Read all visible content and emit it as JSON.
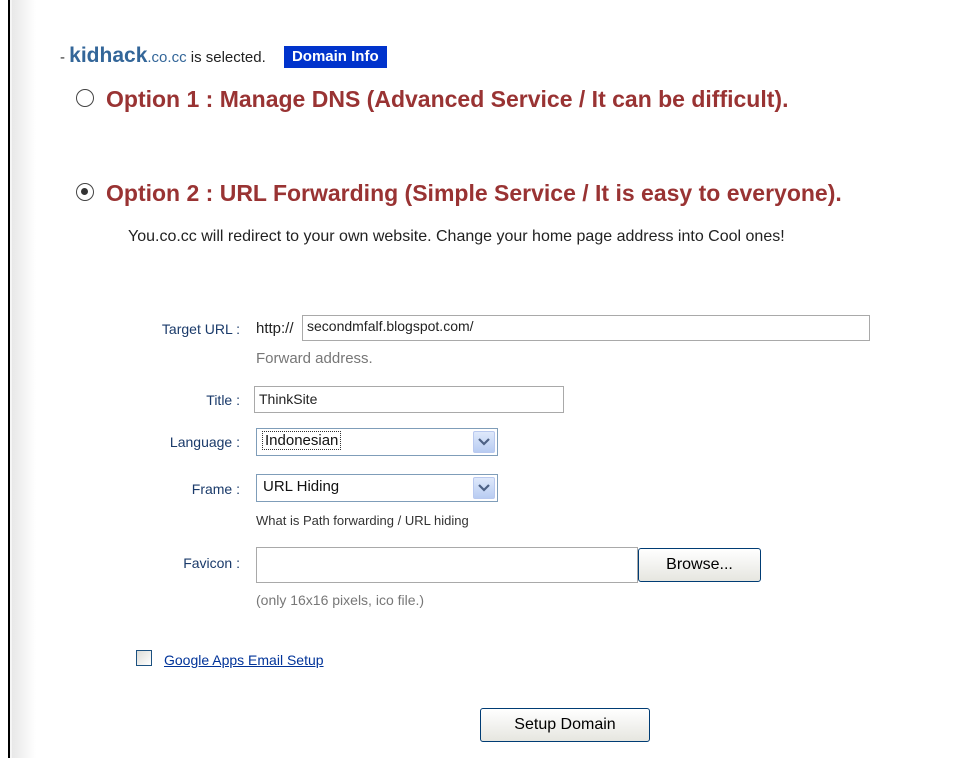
{
  "selection": {
    "dash": "-",
    "domain_name": "kidhack",
    "domain_tld": ".co.cc",
    "suffix": "is selected.",
    "domain_info_button": "Domain Info"
  },
  "options": {
    "option1_label": "Option 1 : Manage DNS (Advanced Service / It can be difficult).",
    "option1_checked": false,
    "option2_label": "Option 2 : URL Forwarding (Simple Service / It is easy to everyone).",
    "option2_checked": true,
    "option2_description": "You.co.cc will redirect to your own website. Change your home page address into Cool ones!"
  },
  "form": {
    "target_url": {
      "label": "Target URL :",
      "prefix": "http://",
      "value": "secondmfalf.blogspot.com/",
      "hint": "Forward address."
    },
    "title": {
      "label": "Title :",
      "value": "ThinkSite"
    },
    "language": {
      "label": "Language :",
      "selected": "Indonesian"
    },
    "frame": {
      "label": "Frame :",
      "selected": "URL Hiding",
      "hint": "What is Path forwarding / URL hiding"
    },
    "favicon": {
      "label": "Favicon :",
      "value": "",
      "browse_button": "Browse...",
      "hint": "(only 16x16 pixels, ico file.)"
    },
    "google_apps": {
      "label": "Google Apps Email Setup",
      "checked": false
    },
    "submit_button": "Setup Domain"
  },
  "colors": {
    "option_heading": "#993333",
    "domain_name": "#336699",
    "domain_info_bg": "#0033cc",
    "field_label": "#1a3a6a"
  }
}
